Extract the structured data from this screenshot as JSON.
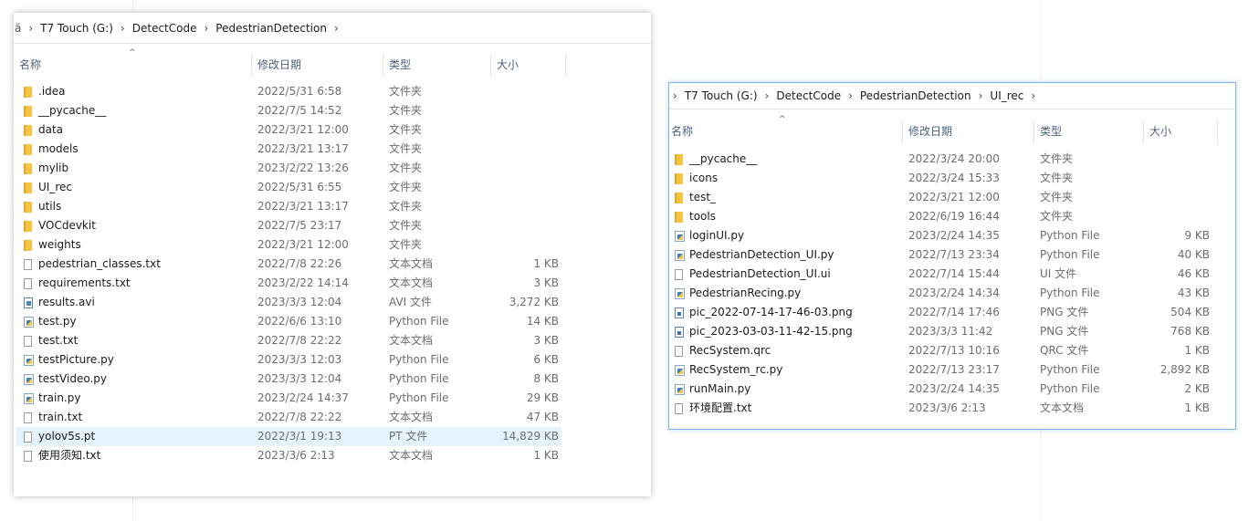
{
  "window1": {
    "breadcrumb_lead": "ä",
    "breadcrumb": [
      "T7 Touch (G:)",
      "DetectCode",
      "PedestrianDetection"
    ],
    "columns": {
      "name": "名称",
      "date": "修改日期",
      "type": "类型",
      "size": "大小"
    },
    "files": [
      {
        "name": ".idea",
        "date": "2022/5/31 6:58",
        "type": "文件夹",
        "size": "",
        "icon": "folder-icon"
      },
      {
        "name": "__pycache__",
        "date": "2022/7/5 14:52",
        "type": "文件夹",
        "size": "",
        "icon": "folder-icon"
      },
      {
        "name": "data",
        "date": "2022/3/21 12:00",
        "type": "文件夹",
        "size": "",
        "icon": "folder-icon"
      },
      {
        "name": "models",
        "date": "2022/3/21 13:17",
        "type": "文件夹",
        "size": "",
        "icon": "folder-icon"
      },
      {
        "name": "mylib",
        "date": "2023/2/22 13:26",
        "type": "文件夹",
        "size": "",
        "icon": "folder-icon"
      },
      {
        "name": "UI_rec",
        "date": "2022/5/31 6:55",
        "type": "文件夹",
        "size": "",
        "icon": "folder-icon"
      },
      {
        "name": "utils",
        "date": "2022/3/21 13:17",
        "type": "文件夹",
        "size": "",
        "icon": "folder-icon"
      },
      {
        "name": "VOCdevkit",
        "date": "2022/7/5 23:17",
        "type": "文件夹",
        "size": "",
        "icon": "folder-icon"
      },
      {
        "name": "weights",
        "date": "2022/3/21 12:00",
        "type": "文件夹",
        "size": "",
        "icon": "folder-icon"
      },
      {
        "name": "pedestrian_classes.txt",
        "date": "2022/7/8 22:26",
        "type": "文本文档",
        "size": "1 KB",
        "icon": "text-file-icon"
      },
      {
        "name": "requirements.txt",
        "date": "2023/2/22 14:14",
        "type": "文本文档",
        "size": "3 KB",
        "icon": "text-file-icon"
      },
      {
        "name": "results.avi",
        "date": "2023/3/3 12:04",
        "type": "AVI 文件",
        "size": "3,272 KB",
        "icon": "video-file-icon"
      },
      {
        "name": "test.py",
        "date": "2022/6/6 13:10",
        "type": "Python File",
        "size": "14 KB",
        "icon": "python-file-icon"
      },
      {
        "name": "test.txt",
        "date": "2022/7/8 22:22",
        "type": "文本文档",
        "size": "3 KB",
        "icon": "text-file-icon"
      },
      {
        "name": "testPicture.py",
        "date": "2023/3/3 12:03",
        "type": "Python File",
        "size": "6 KB",
        "icon": "python-file-icon"
      },
      {
        "name": "testVideo.py",
        "date": "2023/3/3 12:04",
        "type": "Python File",
        "size": "8 KB",
        "icon": "python-file-icon"
      },
      {
        "name": "train.py",
        "date": "2023/2/24 14:37",
        "type": "Python File",
        "size": "29 KB",
        "icon": "python-file-icon"
      },
      {
        "name": "train.txt",
        "date": "2022/7/8 22:22",
        "type": "文本文档",
        "size": "47 KB",
        "icon": "text-file-icon"
      },
      {
        "name": "yolov5s.pt",
        "date": "2022/3/1 19:13",
        "type": "PT 文件",
        "size": "14,829 KB",
        "icon": "text-file-icon",
        "selected": true
      },
      {
        "name": "使用须知.txt",
        "date": "2023/3/6 2:13",
        "type": "文本文档",
        "size": "1 KB",
        "icon": "text-file-icon"
      }
    ]
  },
  "window2": {
    "breadcrumb": [
      "T7 Touch (G:)",
      "DetectCode",
      "PedestrianDetection",
      "UI_rec"
    ],
    "columns": {
      "name": "名称",
      "date": "修改日期",
      "type": "类型",
      "size": "大小"
    },
    "files": [
      {
        "name": "__pycache__",
        "date": "2022/3/24 20:00",
        "type": "文件夹",
        "size": "",
        "icon": "folder-icon"
      },
      {
        "name": "icons",
        "date": "2022/3/24 15:33",
        "type": "文件夹",
        "size": "",
        "icon": "folder-icon"
      },
      {
        "name": "test_",
        "date": "2022/3/21 12:00",
        "type": "文件夹",
        "size": "",
        "icon": "folder-icon"
      },
      {
        "name": "tools",
        "date": "2022/6/19 16:44",
        "type": "文件夹",
        "size": "",
        "icon": "folder-icon"
      },
      {
        "name": "loginUI.py",
        "date": "2023/2/24 14:35",
        "type": "Python File",
        "size": "9 KB",
        "icon": "python-file-icon"
      },
      {
        "name": "PedestrianDetection_UI.py",
        "date": "2022/7/13 23:34",
        "type": "Python File",
        "size": "40 KB",
        "icon": "python-file-icon"
      },
      {
        "name": "PedestrianDetection_UI.ui",
        "date": "2022/7/14 15:44",
        "type": "UI 文件",
        "size": "46 KB",
        "icon": "text-file-icon"
      },
      {
        "name": "PedestrianRecing.py",
        "date": "2023/2/24 14:34",
        "type": "Python File",
        "size": "43 KB",
        "icon": "python-file-icon"
      },
      {
        "name": "pic_2022-07-14-17-46-03.png",
        "date": "2022/7/14 17:46",
        "type": "PNG 文件",
        "size": "504 KB",
        "icon": "image-file-icon"
      },
      {
        "name": "pic_2023-03-03-11-42-15.png",
        "date": "2023/3/3 11:42",
        "type": "PNG 文件",
        "size": "768 KB",
        "icon": "image-file-icon"
      },
      {
        "name": "RecSystem.qrc",
        "date": "2022/7/13 10:16",
        "type": "QRC 文件",
        "size": "1 KB",
        "icon": "text-file-icon"
      },
      {
        "name": "RecSystem_rc.py",
        "date": "2022/7/13 23:17",
        "type": "Python File",
        "size": "2,892 KB",
        "icon": "python-file-icon"
      },
      {
        "name": "runMain.py",
        "date": "2023/2/24 14:35",
        "type": "Python File",
        "size": "2 KB",
        "icon": "python-file-icon"
      },
      {
        "name": "环境配置.txt",
        "date": "2023/3/6 2:13",
        "type": "文本文档",
        "size": "1 KB",
        "icon": "text-file-icon"
      }
    ]
  }
}
